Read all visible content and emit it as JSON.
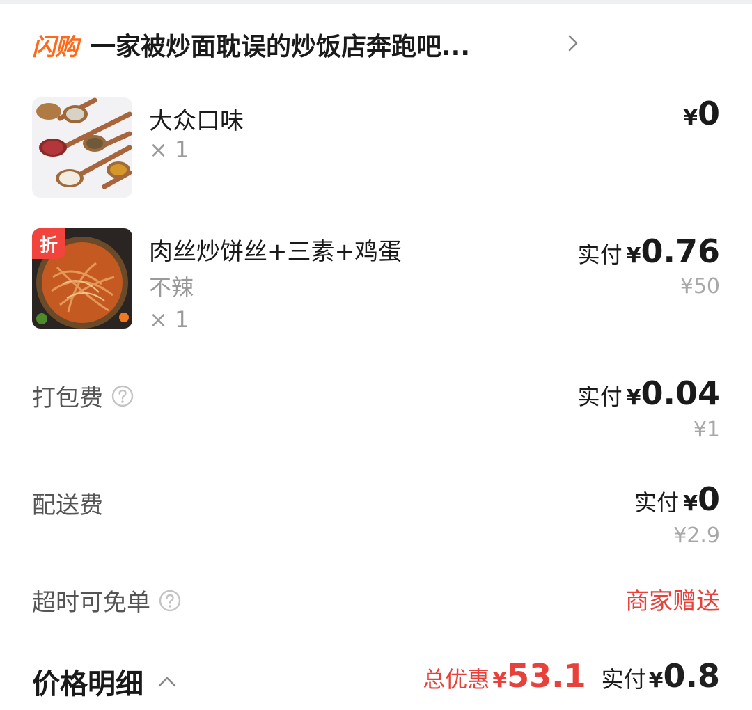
{
  "header": {
    "brand": "闪购",
    "shop_name": "一家被炒面耽误的炒饭店奔跑吧..."
  },
  "items": [
    {
      "name": "大众口味",
      "quantity": "× 1",
      "price_yen": "¥",
      "price": "0"
    },
    {
      "badge": "折",
      "name": "肉丝炒饼丝+三素+鸡蛋",
      "spec": "不辣",
      "quantity": "× 1",
      "pay_label": "实付",
      "price_yen": "¥",
      "price": "0.76",
      "original": "¥50"
    }
  ],
  "fees": {
    "packing": {
      "label": "打包费",
      "pay_label": "实付",
      "yen": "¥",
      "price": "0.04",
      "original": "¥1"
    },
    "delivery": {
      "label": "配送费",
      "pay_label": "实付",
      "yen": "¥",
      "price": "0",
      "original": "¥2.9"
    },
    "overtime": {
      "label": "超时可免单",
      "value": "商家赠送"
    }
  },
  "footer": {
    "title": "价格明细",
    "discount_label": "总优惠",
    "discount_yen": "¥",
    "discount_amount": "53.1",
    "final_label": "实付",
    "final_yen": "¥",
    "final_amount": "0.8"
  },
  "colors": {
    "brand": "#ff6a1a",
    "accent_red": "#e8413c",
    "muted": "#9a9a9a"
  }
}
